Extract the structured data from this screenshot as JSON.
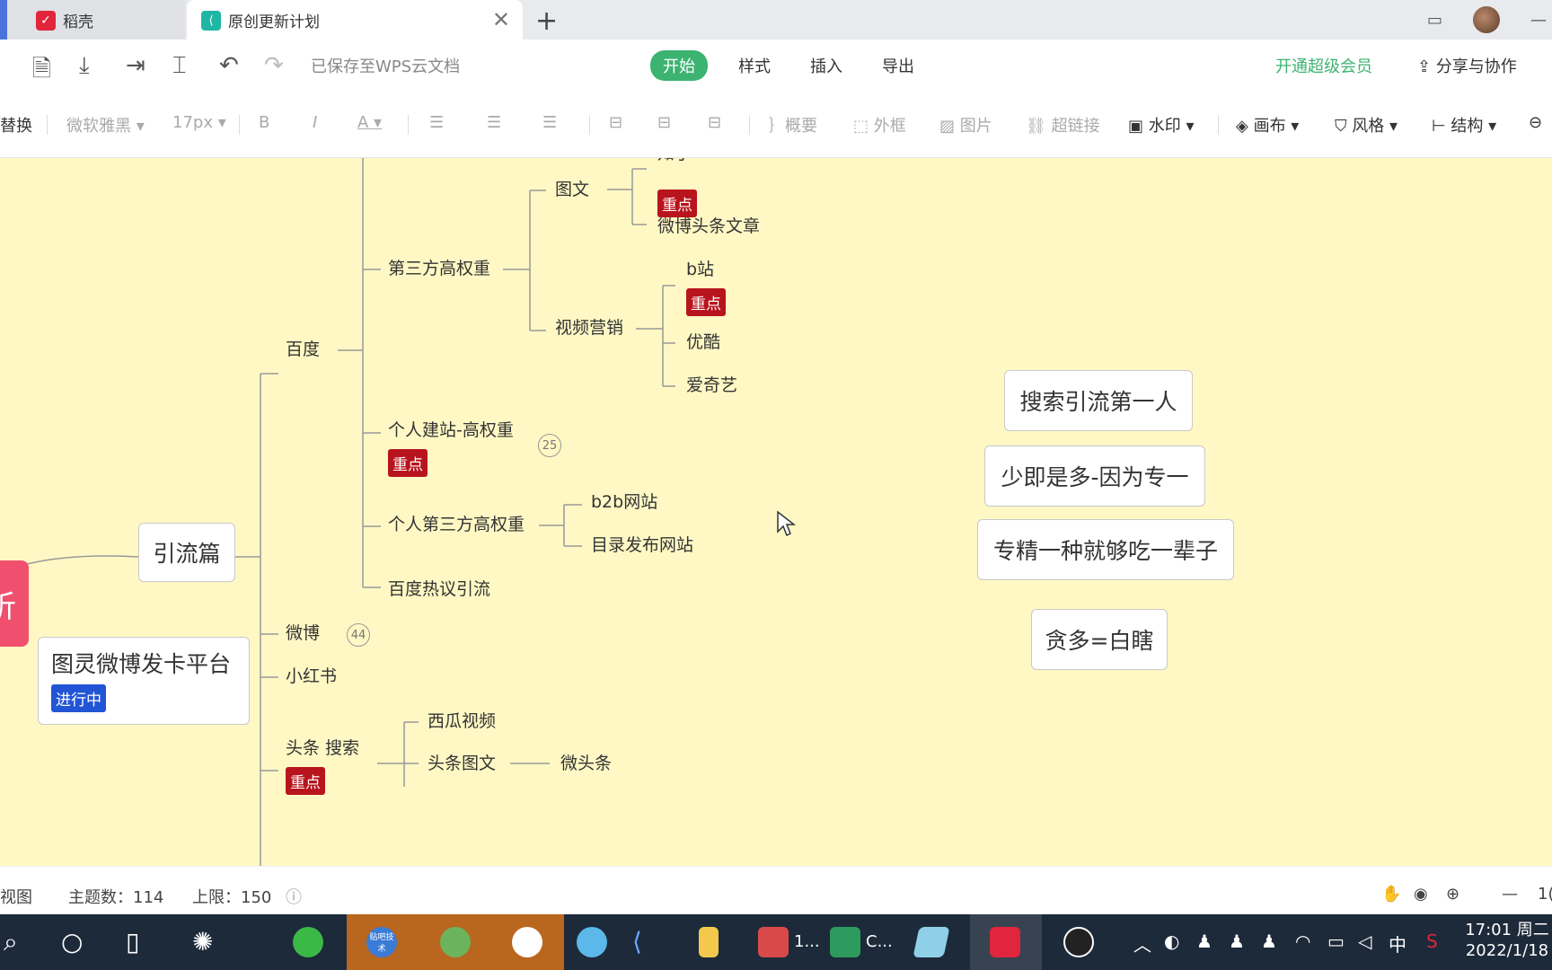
{
  "tabs": [
    {
      "label": "稻壳",
      "logo": "daoke-logo"
    },
    {
      "label": "原创更新计划",
      "logo": "mindmap-logo"
    }
  ],
  "menubar": {
    "save_status": "已保存至WPS云文档",
    "tabs": [
      "开始",
      "样式",
      "插入",
      "导出"
    ],
    "active_tab": "开始",
    "vip": "开通超级会员",
    "share": "分享与协作"
  },
  "toolbar": {
    "replace": "替换",
    "font": "微软雅黑",
    "size": "17px",
    "bold": "B",
    "italic": "I",
    "font_color": "A",
    "summary": "概要",
    "frame": "外框",
    "image": "图片",
    "hyperlink": "超链接",
    "watermark": "水印",
    "canvas": "画布",
    "style": "风格",
    "structure": "结构"
  },
  "mindmap": {
    "root_fragment": "析",
    "main_branch": "引流篇",
    "side_topic": {
      "title": "图灵微博发卡平台",
      "tag": "进行中"
    },
    "nodes": {
      "baidu": "百度",
      "third_party": "第三方高权重",
      "tuwen": "图文",
      "zhihu": "知乎",
      "weibo_toutiao": "微博头条文章",
      "video": "视频营销",
      "bzhan": "b站",
      "youku": "优酷",
      "iqiyi": "爱奇艺",
      "personal_site": "个人建站-高权重",
      "personal_site_count": "25",
      "personal_third": "个人第三方高权重",
      "b2b": "b2b网站",
      "directory": "目录发布网站",
      "baidu_hot": "百度热议引流",
      "weibo": "微博",
      "weibo_count": "44",
      "xiaohongshu": "小红书",
      "toutiao_search": "头条  搜索",
      "xigua": "西瓜视频",
      "toutiao_tuwen": "头条图文",
      "wei_toutiao": "微头条"
    },
    "tag_key": "重点",
    "notes": [
      "搜索引流第一人",
      "少即是多-因为专一",
      "专精一种就够吃一辈子",
      "贪多=白瞎"
    ]
  },
  "statusbar": {
    "view": "视图",
    "topic_count": "主题数：114",
    "limit": "上限：150",
    "zoom_fragment": "1("
  },
  "taskbar": {
    "apps": [
      "贴吧技术",
      "1...",
      "C..."
    ],
    "ime": "中",
    "time": "17:01 周二",
    "date": "2022/1/18"
  }
}
